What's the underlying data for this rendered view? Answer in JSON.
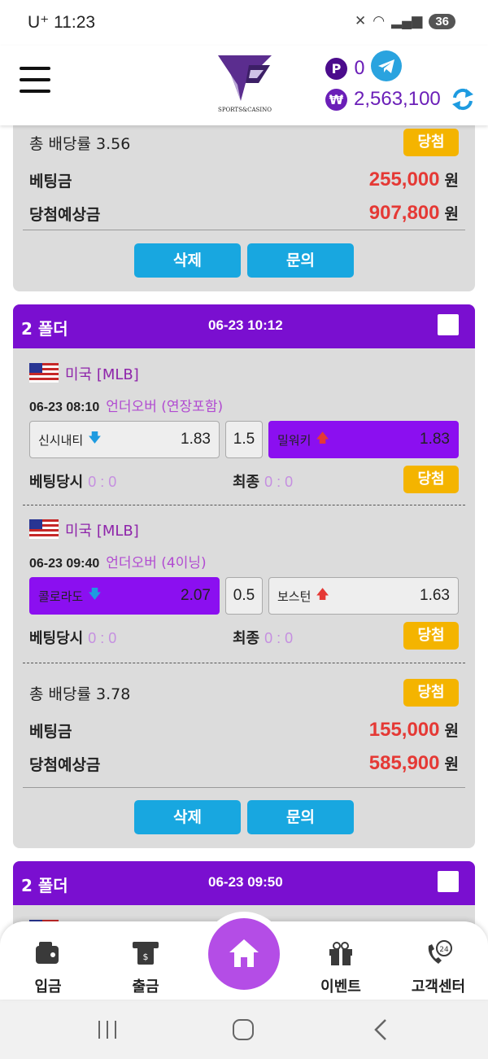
{
  "status": {
    "carrier": "U⁺",
    "time": "11:23",
    "battery": "36"
  },
  "header": {
    "logo_text": "SPORTS&CASINO",
    "point_symbol": "P",
    "points": "0",
    "won_symbol": "₩",
    "balance": "2,563,100"
  },
  "bet1": {
    "total_odds": "총 배당률 3.56",
    "result": "당첨",
    "stake_label": "베팅금",
    "stake": "255,000",
    "payout_label": "당첨예상금",
    "payout": "907,800",
    "unit": "원",
    "delete": "삭제",
    "inquiry": "문의"
  },
  "bet2": {
    "folder": "2 폴더",
    "date": "06-23 10:12",
    "games": [
      {
        "league": "미국 [MLB]",
        "time": "06-23 08:10",
        "type": "언더오버 (연장포함)",
        "home": "신시내티",
        "home_odds": "1.83",
        "line": "1.5",
        "away": "밀워키",
        "away_odds": "1.83",
        "bet_time_label": "베팅당시",
        "bet_score": "0 : 0",
        "final_label": "최종",
        "final_score": "0 : 0",
        "result": "당첨"
      },
      {
        "league": "미국 [MLB]",
        "time": "06-23 09:40",
        "type": "언더오버 (4이닝)",
        "home": "콜로라도",
        "home_odds": "2.07",
        "line": "0.5",
        "away": "보스턴",
        "away_odds": "1.63",
        "bet_time_label": "베팅당시",
        "bet_score": "0 : 0",
        "final_label": "최종",
        "final_score": "0 : 0",
        "result": "당첨"
      }
    ],
    "total_odds": "총 배당률 3.78",
    "result": "당첨",
    "stake_label": "베팅금",
    "stake": "155,000",
    "payout_label": "당첨예상금",
    "payout": "585,900",
    "unit": "원",
    "delete": "삭제",
    "inquiry": "문의"
  },
  "bet3": {
    "folder": "2 폴더",
    "date": "06-23 09:50"
  },
  "nav": {
    "deposit": "입금",
    "withdraw": "출금",
    "event": "이벤트",
    "support": "고객센터",
    "support_badge": "24"
  },
  "colors": {
    "accent": "#7a0fd0",
    "win": "#f4b400",
    "button": "#18a7e0",
    "amount": "#e53935"
  }
}
